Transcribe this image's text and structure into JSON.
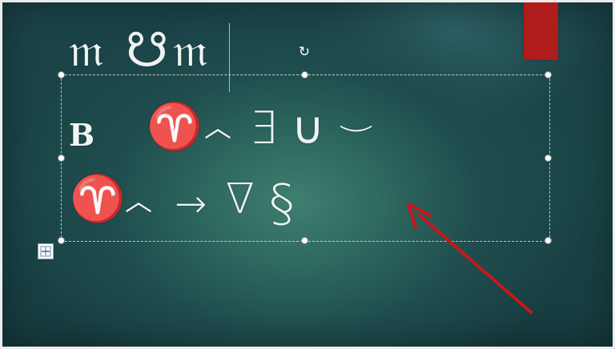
{
  "slide": {
    "title_row": [
      "𝔪",
      "☋",
      "𝔪"
    ],
    "row1": {
      "bold_letter": "B",
      "symbols": [
        "♈",
        "︿",
        "∃",
        "∪",
        "‿"
      ]
    },
    "row2": {
      "symbols": [
        "♈",
        "︿",
        "→",
        "∇",
        "§"
      ]
    }
  },
  "controls": {
    "rotate_icon": "↻",
    "layout_options_icon": "layout-options-icon"
  },
  "colors": {
    "slide_background": "#1f4c4e",
    "accent_red": "#b01b1b",
    "arrow_red": "#c8171a"
  }
}
